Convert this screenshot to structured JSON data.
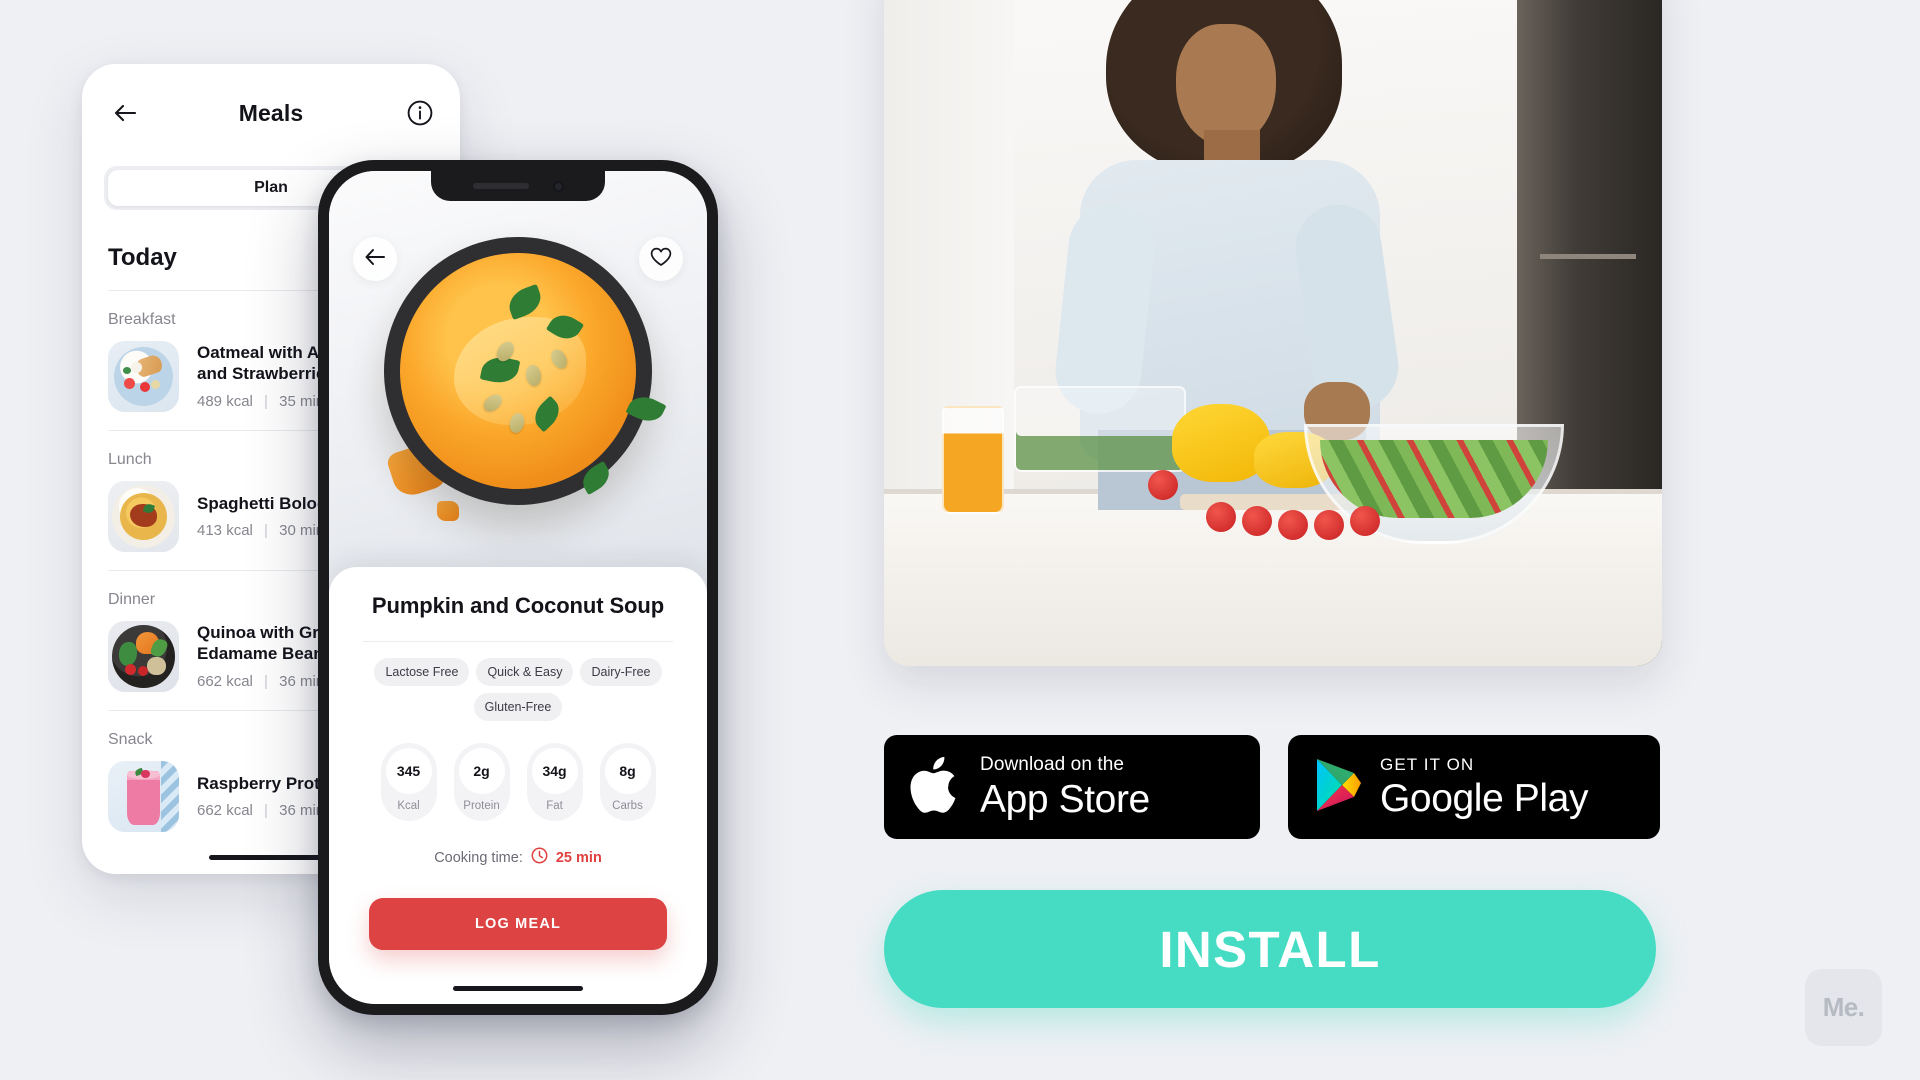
{
  "back_phone": {
    "header": {
      "title": "Meals",
      "back_icon": "arrow-left-icon",
      "info_icon": "info-circle-icon"
    },
    "segmented": {
      "selected": "Plan"
    },
    "day_label": "Today",
    "groups": [
      {
        "label": "Breakfast",
        "meal": {
          "name": "Oatmeal with Almonds and Strawberries",
          "kcal": "489 kcal",
          "time": "35 min",
          "thumb": "oatmeal-strawberries-thumb"
        }
      },
      {
        "label": "Lunch",
        "meal": {
          "name": "Spaghetti Bolognese",
          "kcal": "413 kcal",
          "time": "30 min",
          "thumb": "spaghetti-bolognese-thumb"
        }
      },
      {
        "label": "Dinner",
        "meal": {
          "name": "Quinoa with Greens and Edamame Beans",
          "kcal": "662 kcal",
          "time": "36 min",
          "thumb": "quinoa-bowl-thumb"
        }
      },
      {
        "label": "Snack",
        "meal": {
          "name": "Raspberry Protein Shake",
          "kcal": "662 kcal",
          "time": "36 min",
          "thumb": "raspberry-shake-thumb"
        }
      }
    ],
    "meta_divider": "|"
  },
  "front_phone": {
    "back_icon": "arrow-left-icon",
    "favorite_icon": "heart-icon",
    "hero_image": "pumpkin-coconut-soup-photo",
    "recipe_title": "Pumpkin and Coconut Soup",
    "tags": [
      "Lactose Free",
      "Quick & Easy",
      "Dairy-Free",
      "Gluten-Free"
    ],
    "nutrition": [
      {
        "value": "345",
        "label": "Kcal"
      },
      {
        "value": "2g",
        "label": "Protein"
      },
      {
        "value": "34g",
        "label": "Fat"
      },
      {
        "value": "8g",
        "label": "Carbs"
      }
    ],
    "cooking_time_label": "Cooking time:",
    "cooking_time_value": "25 min",
    "cooking_time_icon": "clock-icon",
    "log_meal_label": "LOG MEAL"
  },
  "promo": {
    "photo_alt": "woman-cooking-salad-photo",
    "app_store": {
      "icon": "apple-logo-icon",
      "small": "Download on the",
      "big": "App Store"
    },
    "google_play": {
      "icon": "google-play-icon",
      "small": "GET IT ON",
      "big": "Google Play"
    },
    "install_label": "INSTALL",
    "watermark": "Me."
  },
  "colors": {
    "accent_red": "#dd4342",
    "install_teal": "#46dcc4",
    "page_bg": "#eff0f4"
  }
}
